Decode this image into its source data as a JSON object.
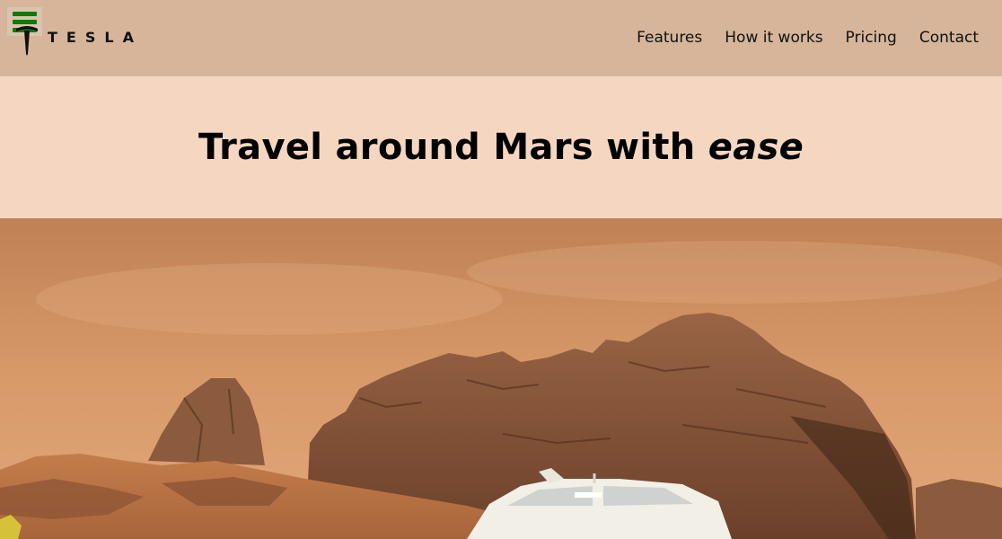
{
  "brand": {
    "name": "TESLA"
  },
  "nav": {
    "items": [
      {
        "label": "Features"
      },
      {
        "label": "How it works"
      },
      {
        "label": "Pricing"
      },
      {
        "label": "Contact"
      }
    ]
  },
  "hero": {
    "title_prefix": "Travel around Mars with ",
    "title_emphasis": "ease"
  },
  "colors": {
    "header_bg": "#d6b59a",
    "hero_bg": "#f5d6c1",
    "menu_icon": "#107a0c"
  }
}
